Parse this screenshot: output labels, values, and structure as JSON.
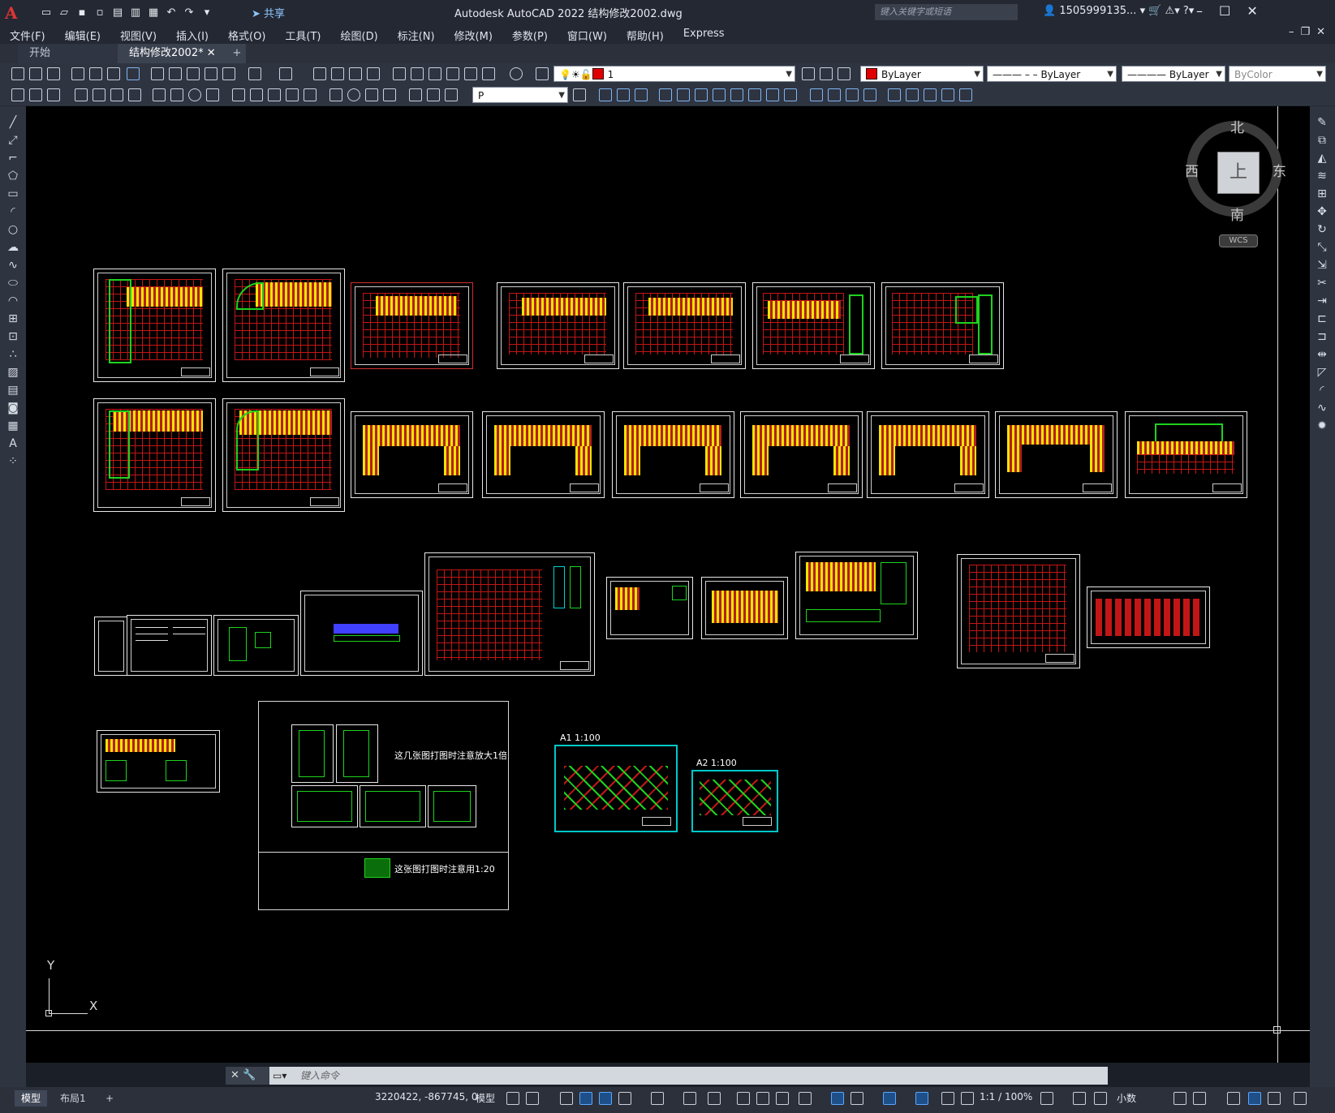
{
  "app": {
    "logo": "A",
    "title": "Autodesk AutoCAD 2022    结构修改2002.dwg",
    "share_label": "共享",
    "search_placeholder": "键入关键字或短语",
    "user": "1505999135..."
  },
  "menu": [
    "文件(F)",
    "编辑(E)",
    "视图(V)",
    "插入(I)",
    "格式(O)",
    "工具(T)",
    "绘图(D)",
    "标注(N)",
    "修改(M)",
    "参数(P)",
    "窗口(W)",
    "帮助(H)",
    "Express"
  ],
  "tabs": {
    "start": "开始",
    "document": "结构修改2002*",
    "add": "+"
  },
  "properties": {
    "layer_value": "1",
    "color_value": "ByLayer",
    "linetype_value": "ByLayer",
    "lineweight_value": "ByLayer",
    "plotstyle_value": "ByColor",
    "style_value": "P"
  },
  "viewcube": {
    "top_face": "上",
    "north": "北",
    "south": "南",
    "east": "东",
    "west": "西",
    "wcs": "WCS"
  },
  "ucs": {
    "x": "X",
    "y": "Y"
  },
  "annotations": {
    "enlarge_note": "这几张图打图时注意放大1倍",
    "scale_note": "这张图打图时注意用1:20",
    "a1_label": "A1   1:100",
    "a2_label": "A2   1:100"
  },
  "command": {
    "placeholder": "键入命令",
    "prompt_icon": "command-prompt-icon"
  },
  "status": {
    "model_tab": "模型",
    "layout_tab": "布局1",
    "add_tab": "+",
    "coordinates": "3220422, -867745, 0",
    "model_space": "模型",
    "annotation_scale": "1:1 / 100%",
    "units": "小数"
  },
  "colors": {
    "canvas": "#000000",
    "accent": "#5aa8ff",
    "red_grid": "#c21616",
    "yellow_members": "#f2e400",
    "green_members": "#1ed21e",
    "cyan_frames": "#00c8c8"
  }
}
